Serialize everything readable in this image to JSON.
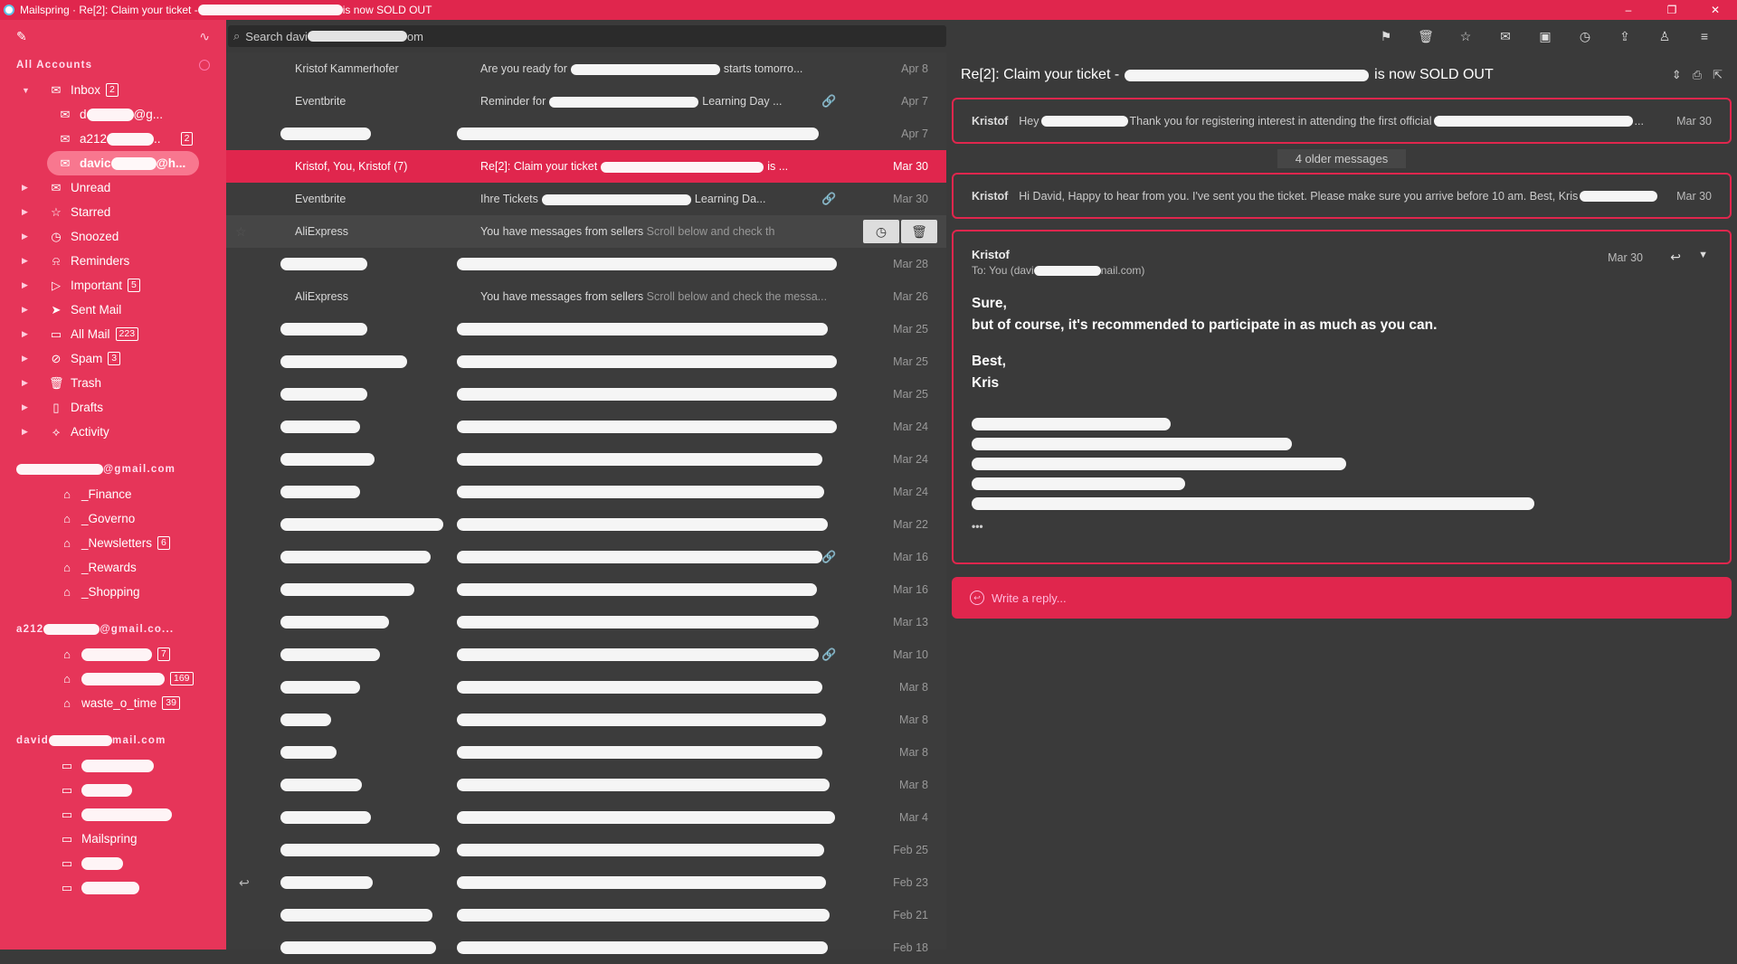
{
  "window": {
    "title_prefix": "Mailspring · Re[2]: Claim your ticket - ",
    "title_suffix": " is now SOLD OUT",
    "controls": [
      "–",
      "❐",
      "✕"
    ]
  },
  "sidebar": {
    "all_accounts": "All Accounts",
    "folders": [
      {
        "label": "Inbox",
        "badge": "2",
        "icon": "inbox-icon"
      },
      {
        "label": "Unread",
        "icon": "unread-icon"
      },
      {
        "label": "Starred",
        "icon": "star-icon"
      },
      {
        "label": "Snoozed",
        "icon": "clock-icon"
      },
      {
        "label": "Reminders",
        "icon": "bell-icon"
      },
      {
        "label": "Important",
        "badge": "5",
        "icon": "important-icon"
      },
      {
        "label": "Sent Mail",
        "icon": "send-icon"
      },
      {
        "label": "All Mail",
        "badge": "223",
        "icon": "folder-icon"
      },
      {
        "label": "Spam",
        "badge": "3",
        "icon": "spam-icon"
      },
      {
        "label": "Trash",
        "icon": "trash-icon"
      },
      {
        "label": "Drafts",
        "icon": "draft-icon"
      },
      {
        "label": "Activity",
        "icon": "activity-icon"
      }
    ],
    "inbox_accounts": [
      {
        "prefix": "d",
        "suffix": "@g..."
      },
      {
        "prefix": "a212",
        "suffix": "..",
        "badge": "2"
      },
      {
        "prefix": "davic",
        "suffix": "@h..."
      }
    ],
    "account1": {
      "suffix": "@gmail.com",
      "labels": [
        {
          "label": "_Finance"
        },
        {
          "label": "_Governo"
        },
        {
          "label": "_Newsletters",
          "badge": "6"
        },
        {
          "label": "_Rewards"
        },
        {
          "label": "_Shopping"
        }
      ]
    },
    "account2": {
      "prefix": "a212",
      "suffix": "@gmail.co...",
      "labels": [
        {
          "label": "",
          "badge": "7"
        },
        {
          "label": "",
          "badge": "169"
        },
        {
          "label": "waste_o_time",
          "badge": "39"
        }
      ]
    },
    "account3": {
      "prefix": "david",
      "suffix": "mail.com",
      "folders": [
        "",
        "",
        "",
        "Mailspring",
        "",
        ""
      ]
    }
  },
  "search": {
    "prefix": "Search davi",
    "suffix": "om"
  },
  "list": [
    {
      "from": "Kristof Kammerhofer",
      "subject": "Are you ready for",
      "snippet": "starts tomorro...",
      "date": "Apr 8"
    },
    {
      "from": "Eventbrite",
      "subject": "Reminder for",
      "snippet": "Learning Day ...",
      "date": "Apr 7",
      "attach": true
    },
    {
      "from": "",
      "subject": "",
      "snippet": "",
      "date": "Apr 7"
    },
    {
      "from": "Kristof, You, Kristof (7)",
      "subject": "Re[2]: Claim your ticket",
      "snippet": "is ...",
      "date": "Mar 30",
      "selected": true
    },
    {
      "from": "Eventbrite",
      "subject": "Ihre Tickets",
      "snippet": "Learning Da...",
      "date": "Mar 30",
      "attach": true
    },
    {
      "from": "AliExpress",
      "subject": "You have messages from sellers",
      "snippet": "Scroll below and check th",
      "date": "",
      "hover": true
    },
    {
      "from": "",
      "subject": "",
      "snippet": "",
      "date": "Mar 28"
    },
    {
      "from": "AliExpress",
      "subject": "You have messages from sellers",
      "snippet": "Scroll below and check the messa...",
      "date": "Mar 26"
    },
    {
      "from": "",
      "subject": "",
      "snippet": "",
      "date": "Mar 25"
    },
    {
      "from": "",
      "subject": "",
      "snippet": "",
      "date": "Mar 25"
    },
    {
      "from": "",
      "subject": "",
      "snippet": "",
      "date": "Mar 25"
    },
    {
      "from": "",
      "subject": "",
      "snippet": "",
      "date": "Mar 24"
    },
    {
      "from": "",
      "subject": "",
      "snippet": "",
      "date": "Mar 24"
    },
    {
      "from": "",
      "subject": "",
      "snippet": "",
      "date": "Mar 24"
    },
    {
      "from": "",
      "subject": "",
      "snippet": "",
      "date": "Mar 22"
    },
    {
      "from": "",
      "subject": "",
      "snippet": "",
      "date": "Mar 16",
      "attach": true
    },
    {
      "from": "",
      "subject": "",
      "snippet": "",
      "date": "Mar 16"
    },
    {
      "from": "",
      "subject": "",
      "snippet": "",
      "date": "Mar 13"
    },
    {
      "from": "",
      "subject": "",
      "snippet": "",
      "date": "Mar 10",
      "attach": true
    },
    {
      "from": "",
      "subject": "",
      "snippet": "",
      "date": "Mar 8"
    },
    {
      "from": "",
      "subject": "",
      "snippet": "",
      "date": "Mar 8"
    },
    {
      "from": "",
      "subject": "",
      "snippet": "",
      "date": "Mar 8"
    },
    {
      "from": "",
      "subject": "",
      "snippet": "",
      "date": "Mar 8"
    },
    {
      "from": "",
      "subject": "",
      "snippet": "",
      "date": "Mar 4"
    },
    {
      "from": "",
      "subject": "",
      "snippet": "",
      "date": "Feb 25"
    },
    {
      "from": "",
      "subject": "",
      "snippet": "",
      "date": "Feb 23",
      "reply": true
    },
    {
      "from": "",
      "subject": "",
      "snippet": "",
      "date": "Feb 21"
    },
    {
      "from": "",
      "subject": "",
      "snippet": "",
      "date": "Feb 18"
    }
  ],
  "reader": {
    "subject_prefix": "Re[2]: Claim your ticket -",
    "subject_suffix": "is now SOLD OUT",
    "msg1": {
      "sender": "Kristof",
      "text_a": "Hey",
      "text_b": "Thank you for registering interest in attending the first official",
      "text_c": "...",
      "date": "Mar 30"
    },
    "older": "4 older messages",
    "msg2": {
      "sender": "Kristof",
      "text": "Hi David, Happy to hear from you. I've sent you the ticket. Please make sure you arrive before 10 am. Best, Kris",
      "date": "Mar 30"
    },
    "msg3": {
      "sender": "Kristof",
      "to_prefix": "To: You (davi",
      "to_suffix": "nail.com)",
      "date": "Mar 30",
      "lines": [
        "Sure,",
        "but of course, it's recommended to participate in as much as you can."
      ],
      "sig": [
        "Best,",
        "Kris"
      ],
      "ellipsis": "•••"
    },
    "reply_placeholder": "Write a reply..."
  },
  "colors": {
    "accent": "#e0264d",
    "sidebar": "#e63559",
    "bg": "#3a3a3a"
  }
}
